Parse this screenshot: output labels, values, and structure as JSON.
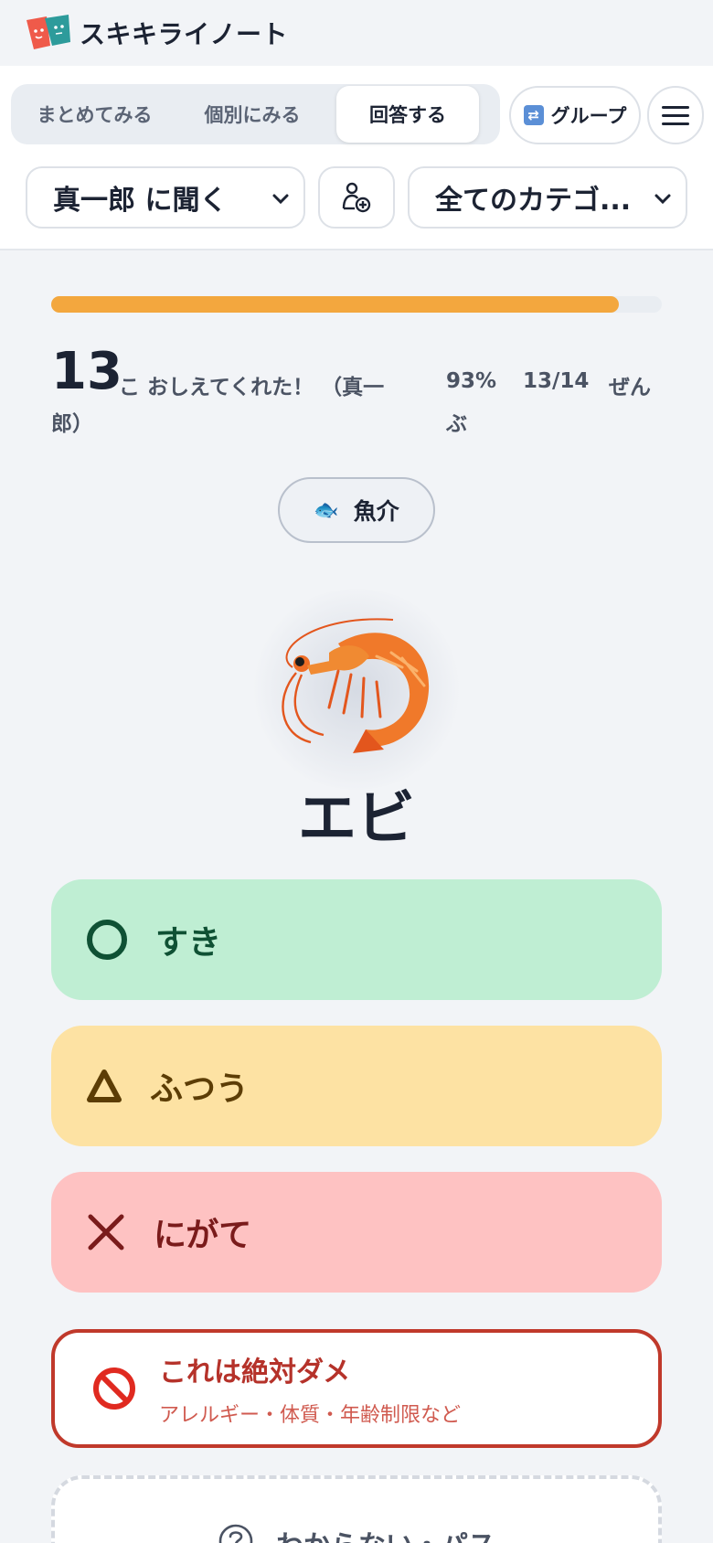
{
  "brand": {
    "name": "スキキライノート"
  },
  "tabs": [
    {
      "label": "まとめてみる",
      "active": false
    },
    {
      "label": "個別にみる",
      "active": false
    },
    {
      "label": "回答する",
      "active": true
    }
  ],
  "group_button": {
    "label": "グループ",
    "icon": "shuffle-icon"
  },
  "menu_button": {
    "icon": "hamburger-menu-icon"
  },
  "person_select": {
    "value": "真一郎 に聞く"
  },
  "add_person_button": {
    "icon": "add-person-icon"
  },
  "category_select": {
    "value": "全てのカテゴ..."
  },
  "progress": {
    "fraction": 0.93,
    "count": "13",
    "count_label": "こ おしえてくれた！ （真一",
    "count_label_cont": "郎）",
    "percent": "93%",
    "ratio": "13/14",
    "total_label": "ぜん",
    "total_label_cont": "ぶ"
  },
  "category_pill": {
    "icon": "fish-icon",
    "label": "魚介"
  },
  "food": {
    "icon": "shrimp-icon",
    "name": "エビ"
  },
  "answers": {
    "like": {
      "label": "すき",
      "icon": "circle-icon",
      "color": "#bfeed3"
    },
    "ok": {
      "label": "ふつう",
      "icon": "triangle-icon",
      "color": "#fde2a3"
    },
    "dislike": {
      "label": "にがて",
      "icon": "cross-icon",
      "color": "#fec2c2"
    },
    "never": {
      "title": "これは絶対ダメ",
      "subtitle": "アレルギー・体質・年齢制限など",
      "icon": "prohibited-icon",
      "color": "#c0392b"
    },
    "pass": {
      "label": "わからない・パス",
      "icon": "question-icon"
    }
  },
  "colors": {
    "accent": "#f3a73e",
    "background": "#f2f4f7"
  }
}
